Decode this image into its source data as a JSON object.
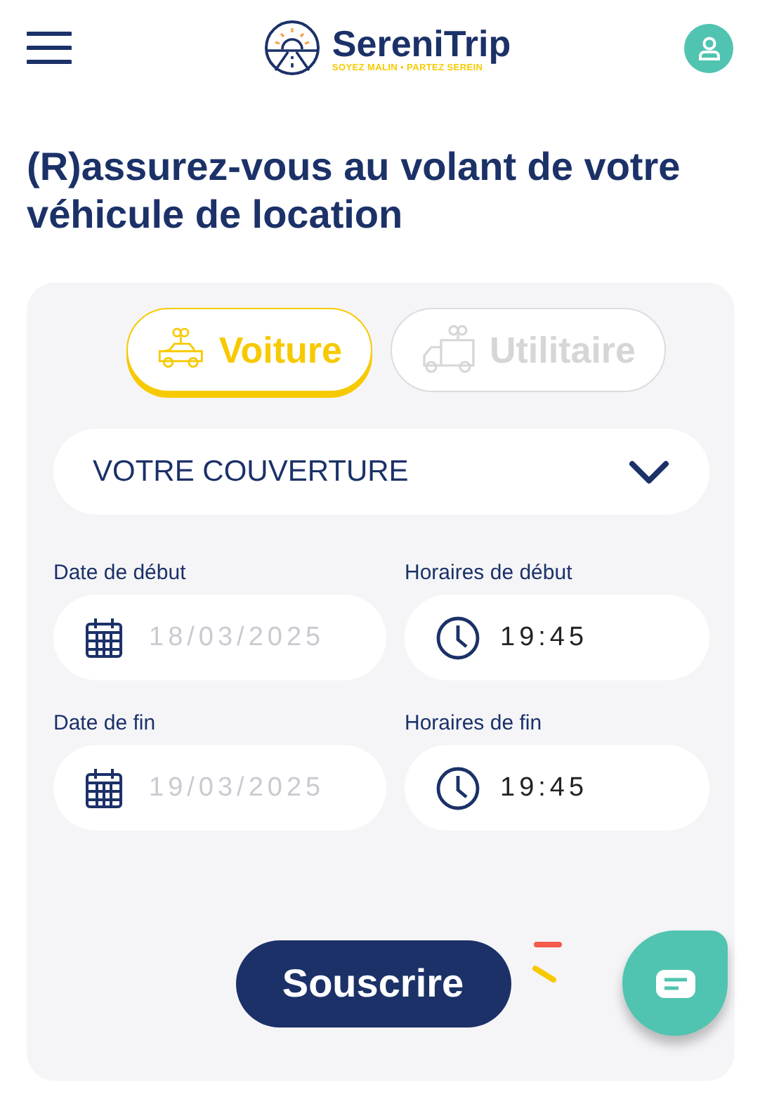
{
  "header": {
    "logo_name": "SereniTrip",
    "logo_tagline": "SOYEZ MALIN • PARTEZ SEREIN"
  },
  "title": "(R)assurez-vous au volant de votre véhicule de location",
  "vehicle_tabs": [
    {
      "label": "Voiture",
      "kind": "car",
      "selected": true
    },
    {
      "label": "Utilitaire",
      "kind": "van",
      "selected": false
    }
  ],
  "coverage": {
    "value": "VOTRE COUVERTURE"
  },
  "fields": [
    {
      "label": "Date de début",
      "kind": "date",
      "placeholder": "18/03/2025"
    },
    {
      "label": "Horaires de début",
      "kind": "time",
      "value": "19:45"
    },
    {
      "label": "Date de fin",
      "kind": "date",
      "placeholder": "19/03/2025"
    },
    {
      "label": "Horaires de fin",
      "kind": "time",
      "value": "19:45"
    }
  ],
  "submit": "Souscrire"
}
